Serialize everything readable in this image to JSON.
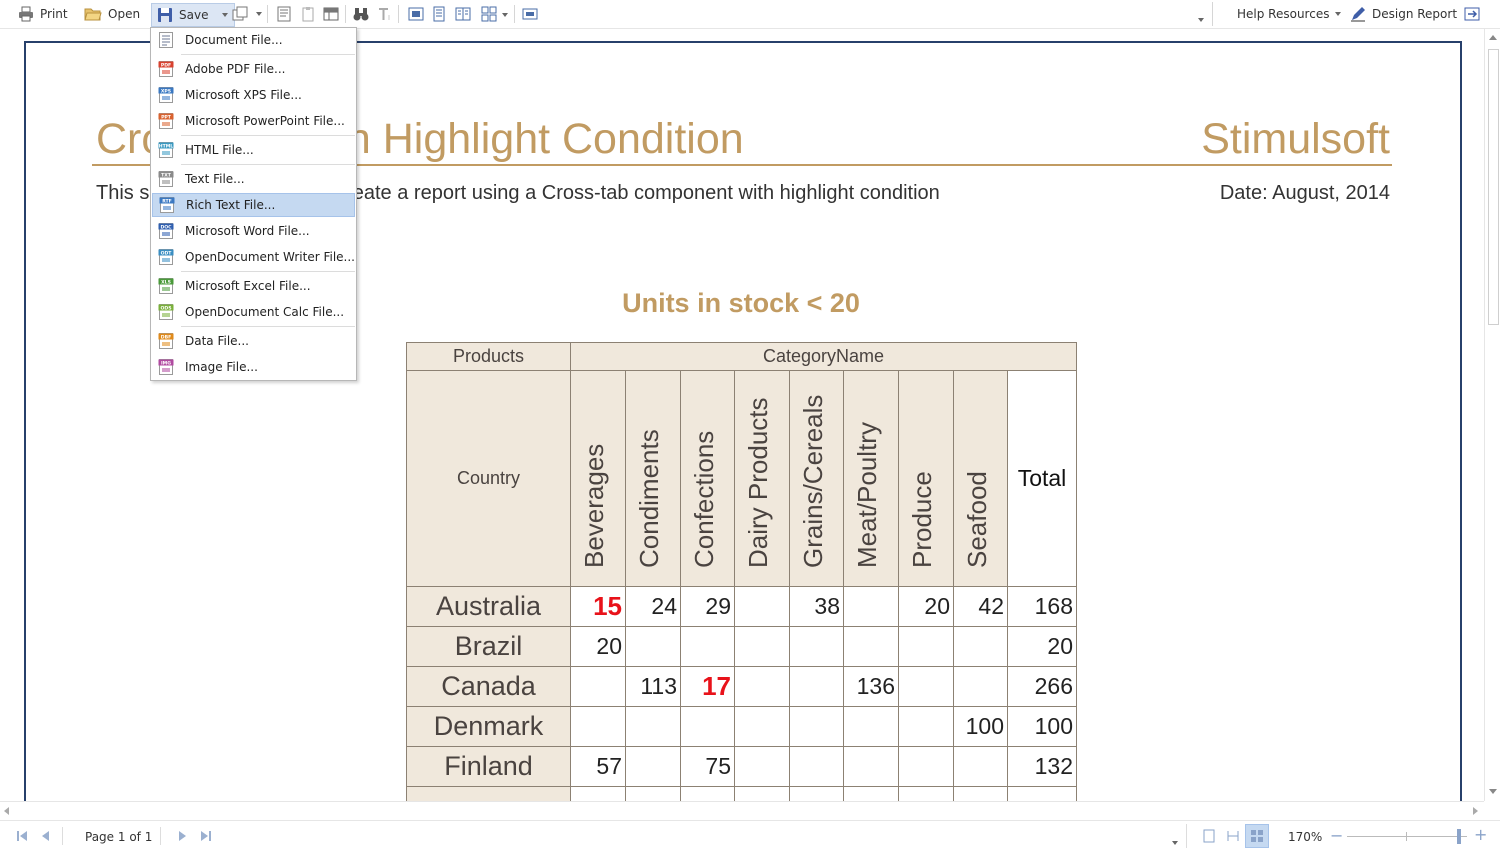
{
  "toolbar": {
    "print_label": "Print",
    "open_label": "Open",
    "save_label": "Save",
    "help_label": "Help Resources",
    "design_label": "Design Report"
  },
  "save_menu": {
    "items": [
      {
        "label": "Document File...",
        "icon": "document-file-icon"
      },
      {
        "label": "Adobe PDF File...",
        "icon": "pdf-file-icon"
      },
      {
        "label": "Microsoft XPS File...",
        "icon": "xps-file-icon"
      },
      {
        "label": "Microsoft PowerPoint File...",
        "icon": "ppt-file-icon"
      },
      {
        "label": "HTML File...",
        "icon": "html-file-icon"
      },
      {
        "label": "Text File...",
        "icon": "txt-file-icon"
      },
      {
        "label": "Rich Text File...",
        "icon": "rtf-file-icon",
        "selected": true
      },
      {
        "label": "Microsoft Word File...",
        "icon": "doc-file-icon"
      },
      {
        "label": "OpenDocument Writer File...",
        "icon": "odt-file-icon"
      },
      {
        "label": "Microsoft Excel File...",
        "icon": "xls-file-icon"
      },
      {
        "label": "OpenDocument Calc File...",
        "icon": "ods-file-icon"
      },
      {
        "label": "Data File...",
        "icon": "data-file-icon"
      },
      {
        "label": "Image File...",
        "icon": "image-file-icon"
      }
    ],
    "icon_tags": [
      "",
      "PDF",
      "XPS",
      "PPT",
      "HTML",
      "TXT",
      "RTF",
      "DOC",
      "ODT",
      "XLS",
      "ODS",
      "DBF",
      "IMG"
    ]
  },
  "report": {
    "title": "Cross-tab with Highlight Condition",
    "brand": "Stimulsoft",
    "description": "This sample shows how to create a report using a Cross-tab component with highlight condition",
    "date": "Date: August, 2014",
    "subtitle": "Units in stock < 20"
  },
  "crosstab": {
    "products_label": "Products",
    "category_label": "CategoryName",
    "country_label": "Country",
    "total_label": "Total",
    "categories": [
      "Beverages",
      "Condiments",
      "Confections",
      "Dairy Products",
      "Grains/Cereals",
      "Meat/Poultry",
      "Produce",
      "Seafood"
    ],
    "rows": [
      {
        "country": "Australia",
        "values": [
          15,
          24,
          29,
          null,
          38,
          null,
          20,
          42
        ],
        "total": 168,
        "highlight": [
          0
        ]
      },
      {
        "country": "Brazil",
        "values": [
          20,
          null,
          null,
          null,
          null,
          null,
          null,
          null
        ],
        "total": 20,
        "highlight": []
      },
      {
        "country": "Canada",
        "values": [
          null,
          113,
          17,
          null,
          null,
          136,
          null,
          null
        ],
        "total": 266,
        "highlight": [
          2
        ]
      },
      {
        "country": "Denmark",
        "values": [
          null,
          null,
          null,
          null,
          null,
          null,
          null,
          100
        ],
        "total": 100,
        "highlight": []
      },
      {
        "country": "Finland",
        "values": [
          57,
          null,
          75,
          null,
          null,
          null,
          null,
          null
        ],
        "total": 132,
        "highlight": []
      }
    ]
  },
  "statusbar": {
    "page_label": "Page 1 of 1",
    "zoom_label": "170%"
  },
  "colors": {
    "accent": "#c19b62",
    "highlight": "#e8121a",
    "header_bg": "#f0e8dc",
    "menu_selected": "#c5d9f1"
  }
}
